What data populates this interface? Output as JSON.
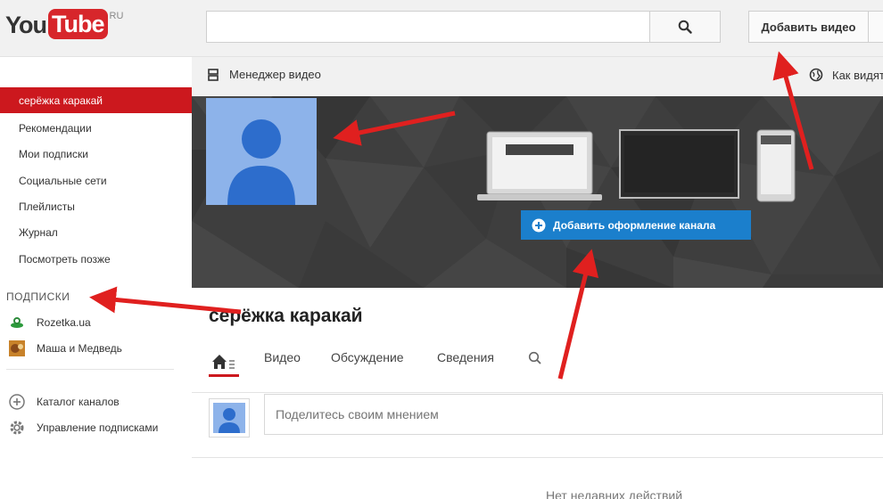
{
  "header": {
    "logo_you": "You",
    "logo_tube": "Tube",
    "logo_region": "RU",
    "search_placeholder": "",
    "upload_label": "Добавить видео"
  },
  "sidebar": {
    "items": [
      {
        "label": "серёжка каракай",
        "active": true
      },
      {
        "label": "Рекомендации"
      },
      {
        "label": "Мои подписки"
      },
      {
        "label": "Социальные сети"
      },
      {
        "label": "Плейлисты"
      },
      {
        "label": "Журнал"
      },
      {
        "label": "Посмотреть позже"
      }
    ],
    "subscriptions_heading": "ПОДПИСКИ",
    "subscriptions": [
      {
        "label": "Rozetka.ua",
        "icon": "rozetka-icon"
      },
      {
        "label": "Маша и Медведь",
        "icon": "masha-icon"
      }
    ],
    "footer_items": [
      {
        "label": "Каталог каналов",
        "icon": "plus-circle-icon"
      },
      {
        "label": "Управление подписками",
        "icon": "gear-icon"
      }
    ]
  },
  "main": {
    "video_manager_label": "Менеджер видео",
    "view_as_label": "Как видят",
    "add_art_label": "Добавить оформление канала",
    "channel_name": "серёжка каракай",
    "tabs": [
      {
        "label": "Видео"
      },
      {
        "label": "Обсуждение"
      },
      {
        "label": "Сведения"
      }
    ],
    "post_placeholder": "Поделитесь своим мнением",
    "no_activity_text": "Нет недавних действий"
  },
  "colors": {
    "accent_red": "#cc181e",
    "button_blue": "#1b7fcc",
    "avatar_blue": "#2d6dcc",
    "annotation_red": "#e0201f"
  }
}
